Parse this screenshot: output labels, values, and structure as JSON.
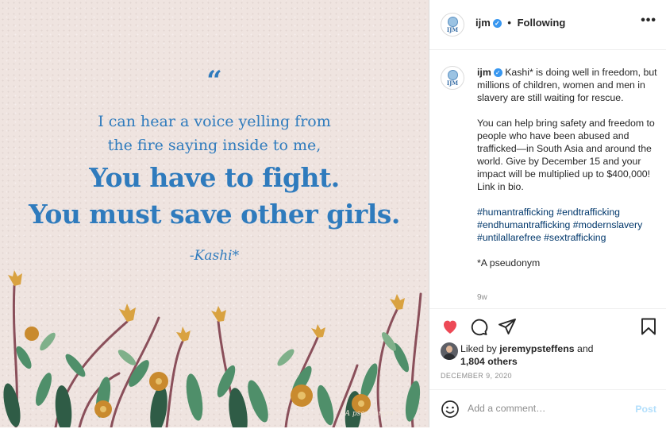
{
  "post_image": {
    "quote_mark": "“",
    "lines": [
      "I can hear a voice yelling from",
      "the fire saying inside to me,",
      "You have to fight.",
      "You must save other girls."
    ],
    "author": "-Kashi*",
    "watermark": "*A pseudonym",
    "text_color": "#2f7bbd",
    "background": "#efe4e0"
  },
  "header": {
    "username": "ijm",
    "avatar_text": "IJM",
    "separator": "•",
    "follow_status": "Following",
    "more_icon": "•••"
  },
  "caption": {
    "username": "ijm",
    "paragraph1": "Kashi* is doing well in freedom, but millions of children, women and men in slavery are still waiting for rescue.",
    "paragraph2": "You can help bring safety and freedom to people who have been abused and trafficked—in South Asia and around the world. Give by December 15 and your impact will be multiplied up to $400,000! Link in bio.",
    "hashtags": [
      "#humantrafficking",
      "#endtrafficking",
      "#endhumantrafficking",
      "#modernslavery",
      "#untilallarefree",
      "#sextrafficking"
    ],
    "footnote": "*A pseudonym",
    "age": "9w"
  },
  "actions": {
    "liked": true,
    "like_color": "#ed4956"
  },
  "likes": {
    "prefix": "Liked by",
    "liker": "jeremypsteffens",
    "and": "and",
    "others": "1,804 others"
  },
  "date": "DECEMBER 9, 2020",
  "comment": {
    "placeholder": "Add a comment…",
    "post_label": "Post"
  }
}
